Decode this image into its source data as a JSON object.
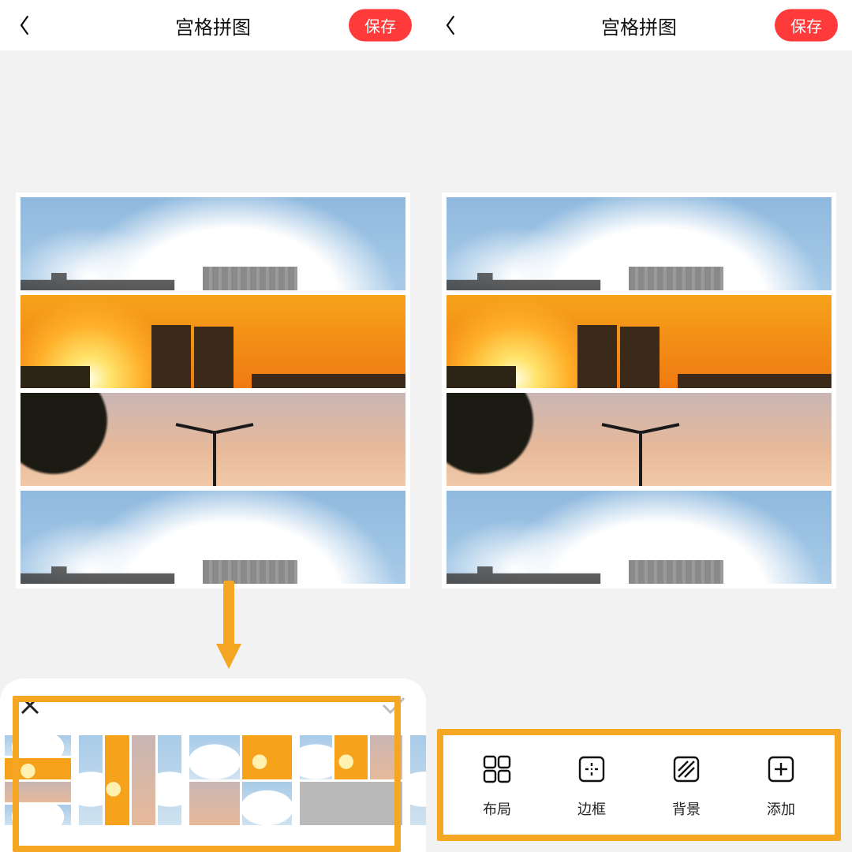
{
  "accent": "#ff3a3a",
  "highlight": "#f5a623",
  "header": {
    "title": "宫格拼图",
    "save_label": "保存"
  },
  "left_drawer": {
    "close_icon": "close-icon",
    "confirm_icon": "check-icon"
  },
  "right_toolbar": {
    "items": [
      {
        "name": "layout",
        "label": "布局",
        "icon": "grid-layout-icon"
      },
      {
        "name": "border",
        "label": "边框",
        "icon": "border-icon"
      },
      {
        "name": "background",
        "label": "背景",
        "icon": "background-icon"
      },
      {
        "name": "add",
        "label": "添加",
        "icon": "plus-icon"
      }
    ]
  }
}
